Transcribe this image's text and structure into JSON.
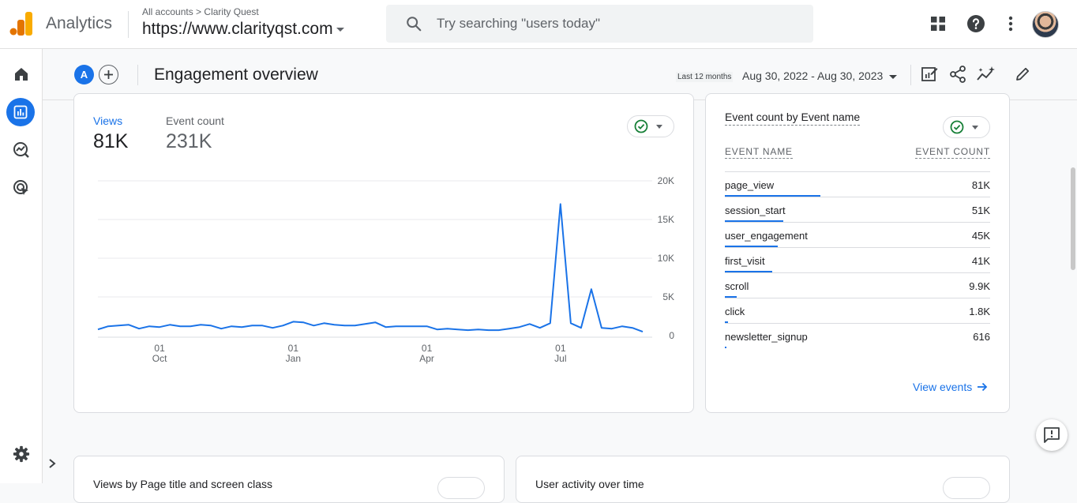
{
  "app": {
    "name": "Analytics",
    "breadcrumb_root": "All accounts",
    "breadcrumb_account": "Clarity Quest",
    "property": "https://www.clarityqst.com"
  },
  "search": {
    "placeholder": "Try searching \"users today\""
  },
  "colors": {
    "accent": "#1a73e8",
    "logo_orange": "#f9ab00",
    "logo_dark": "#e37400",
    "check_green": "#188038"
  },
  "icons": {
    "topbar": [
      "apps-grid-icon",
      "help-icon",
      "more-vert-icon"
    ],
    "sidebar": [
      "home-icon",
      "reports-icon",
      "explore-icon",
      "advertising-icon",
      "settings-icon"
    ]
  },
  "header": {
    "compare_badge": "A",
    "title": "Engagement overview",
    "date_label": "Last 12 months",
    "date_range": "Aug 30, 2022 - Aug 30, 2023"
  },
  "main_card": {
    "metric_active_label": "Views",
    "metric_active_value": "81K",
    "metric_inactive_label": "Event count",
    "metric_inactive_value": "231K"
  },
  "chart_data": {
    "type": "line",
    "title": "",
    "xlabel": "",
    "ylabel": "",
    "ylim": [
      0,
      20000
    ],
    "y_ticks": [
      "20K",
      "15K",
      "10K",
      "5K",
      "0"
    ],
    "y_tick_values": [
      20000,
      15000,
      10000,
      5000,
      0
    ],
    "x_ticks": [
      {
        "day": "01",
        "month": "Oct",
        "index": 6
      },
      {
        "day": "01",
        "month": "Jan",
        "index": 19
      },
      {
        "day": "01",
        "month": "Apr",
        "index": 32
      },
      {
        "day": "01",
        "month": "Jul",
        "index": 45
      }
    ],
    "series": [
      {
        "values": [
          800,
          1200,
          1300,
          1400,
          900,
          1200,
          1100,
          1400,
          1200,
          1200,
          1400,
          1300,
          900,
          1200,
          1100,
          1300,
          1300,
          1000,
          1300,
          1800,
          1700,
          1300,
          1600,
          1400,
          1300,
          1300,
          1500,
          1700,
          1100,
          1200,
          1200,
          1200,
          1200,
          800,
          900,
          800,
          700,
          800,
          700,
          700,
          900,
          1100,
          1500,
          1000,
          1600,
          17000,
          1600,
          1000,
          6000,
          1000,
          900,
          1200,
          1000,
          500
        ]
      }
    ],
    "grid": true
  },
  "events_card": {
    "title": "Event count by Event name",
    "col_name": "EVENT NAME",
    "col_count": "EVENT COUNT",
    "rows": [
      {
        "name": "page_view",
        "count": "81K",
        "share": 0.36
      },
      {
        "name": "session_start",
        "count": "51K",
        "share": 0.22
      },
      {
        "name": "user_engagement",
        "count": "45K",
        "share": 0.2
      },
      {
        "name": "first_visit",
        "count": "41K",
        "share": 0.18
      },
      {
        "name": "scroll",
        "count": "9.9K",
        "share": 0.045
      },
      {
        "name": "click",
        "count": "1.8K",
        "share": 0.012
      },
      {
        "name": "newsletter_signup",
        "count": "616",
        "share": 0.004
      }
    ],
    "view_link": "View events"
  },
  "bottom_cards": {
    "left_title": "Views by Page title and screen class",
    "right_title": "User activity over time"
  }
}
